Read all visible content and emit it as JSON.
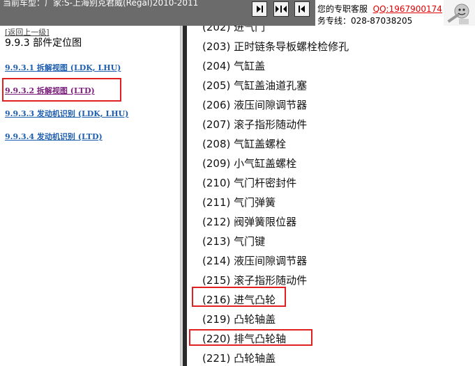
{
  "header": {
    "vehicle_text": "当前车型：厂家:S-上海别克君威(Regal)2010-2011",
    "nav_buttons": [
      {
        "icon": "step-forward-icon"
      },
      {
        "icon": "expand-arrows-icon"
      },
      {
        "icon": "step-back-icon"
      }
    ],
    "support_line1": "您的专职客服",
    "support_qq": "QQ:1967900174",
    "support_line2": "务专线：028-87038205"
  },
  "left_panel": {
    "back_link": "[返回上一级]",
    "section_title": "9.9.3 部件定位图",
    "links": [
      {
        "label": "9.9.3.1 拆解视图 (LDK, LHU)",
        "visited": false
      },
      {
        "label": "9.9.3.2 拆解视图 (LTD)",
        "visited": true,
        "highlighted": true
      },
      {
        "label": "9.9.3.3 发动机识别 (LDK, LHU)",
        "visited": false
      },
      {
        "label": "9.9.3.4 发动机识别 (LTD)",
        "visited": false
      }
    ]
  },
  "right_panel": {
    "items": [
      {
        "label": "(202) 进气门",
        "highlighted": false
      },
      {
        "label": "(203) 正时链条导板螺栓检修孔",
        "highlighted": false
      },
      {
        "label": "(204) 气缸盖",
        "highlighted": false
      },
      {
        "label": "(205) 气缸盖油道孔塞",
        "highlighted": false
      },
      {
        "label": "(206) 液压间隙调节器",
        "highlighted": false
      },
      {
        "label": "(207) 滚子指形随动件",
        "highlighted": false
      },
      {
        "label": "(208) 气缸盖螺栓",
        "highlighted": false
      },
      {
        "label": "(209) 小气缸盖螺栓",
        "highlighted": false
      },
      {
        "label": "(210) 气门杆密封件",
        "highlighted": false
      },
      {
        "label": "(211) 气门弹簧",
        "highlighted": false
      },
      {
        "label": "(212) 阀弹簧限位器",
        "highlighted": false
      },
      {
        "label": "(213) 气门键",
        "highlighted": false
      },
      {
        "label": "(214) 液压间隙调节器",
        "highlighted": false
      },
      {
        "label": "(215) 滚子指形随动件",
        "highlighted": false
      },
      {
        "label": "(216) 进气凸轮",
        "highlighted": true
      },
      {
        "label": "(219) 凸轮轴盖",
        "highlighted": false
      },
      {
        "label": "(220) 排气凸轮轴",
        "highlighted": true
      },
      {
        "label": "(221) 凸轮轴盖",
        "highlighted": false
      }
    ]
  },
  "colors": {
    "header_bg": "#6b6b6b",
    "link": "#1f5fb0",
    "visited_link": "#7a1f7a",
    "highlight_box": "#e02020",
    "qq": "#e00000"
  }
}
